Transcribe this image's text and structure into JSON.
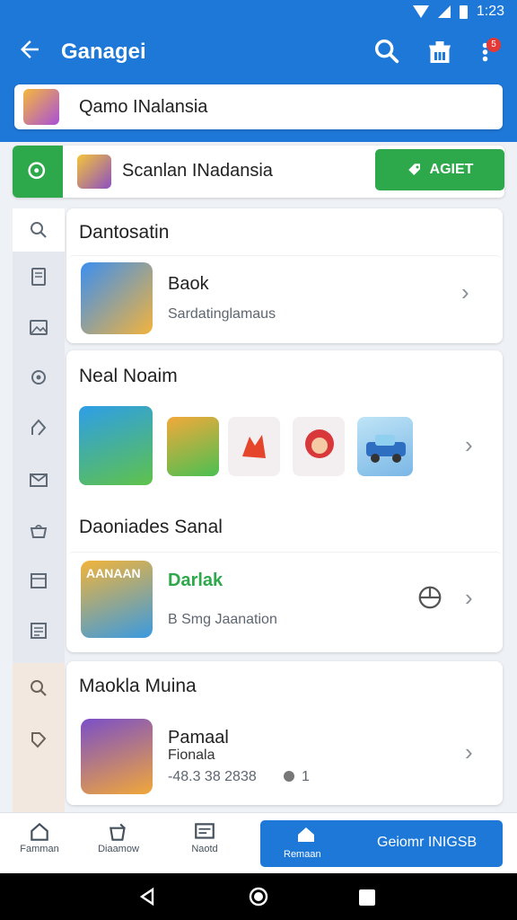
{
  "status_bar": {
    "time": "1:23"
  },
  "app_bar": {
    "title": "Ganagei",
    "notification_count": "5"
  },
  "search": {
    "value": "Qamo INalansia",
    "placeholder": "Qamo INalansia"
  },
  "filter": {
    "text": "Scanlan INadansia",
    "button_label": "AGIET"
  },
  "section_1": {
    "title": "Dantosatin",
    "item": {
      "title": "Baok",
      "subtitle": "Sardatinglamaus"
    }
  },
  "section_2": {
    "title": "Neal Noaim"
  },
  "section_3": {
    "title": "Daoniades Sanal",
    "item": {
      "title": "Darlak",
      "subtitle": "B Smg Jaanation",
      "banner_text": "AANAAN"
    }
  },
  "section_4": {
    "title": "Maokla Muina",
    "item": {
      "title": "Pamaal",
      "subtitle": "Fionala",
      "meta": "-48.3 38 2838",
      "meta_count": "1"
    }
  },
  "bottom_nav": {
    "items": [
      {
        "label": "Famman",
        "icon": "home-outline-icon"
      },
      {
        "label": "Diaamow",
        "icon": "games-icon"
      },
      {
        "label": "Naotd",
        "icon": "news-icon"
      }
    ],
    "active": {
      "label": "Remaan",
      "extra": "Geiomr INIGSB"
    }
  },
  "colors": {
    "primary": "#1e78d8",
    "accent_green": "#2da84a",
    "badge_red": "#e53935"
  }
}
